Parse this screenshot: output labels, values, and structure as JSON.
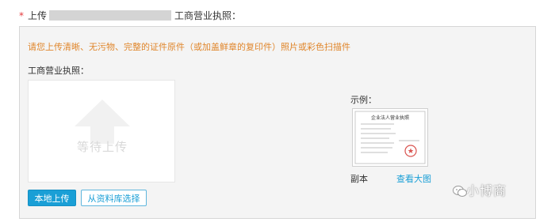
{
  "field": {
    "required_mark": "*",
    "label_prefix": "上传",
    "label_suffix": "工商营业执照："
  },
  "panel": {
    "hint": "请您上传清晰、无污物、完整的证件原件（或加盖鲜章的复印件）照片或彩色扫描件",
    "upload_label": "工商营业执照：",
    "upload_placeholder": "等待上传",
    "buttons": {
      "local_upload": "本地上传",
      "from_library": "从资料库选择"
    },
    "example": {
      "label": "示例：",
      "doc_title": "企业法人营业执照",
      "caption": "副本",
      "view_large": "查看大图"
    }
  },
  "watermark": {
    "text": "小博商"
  },
  "colors": {
    "accent": "#1a9fd6",
    "hint": "#e0862b",
    "required": "#e4393c"
  }
}
